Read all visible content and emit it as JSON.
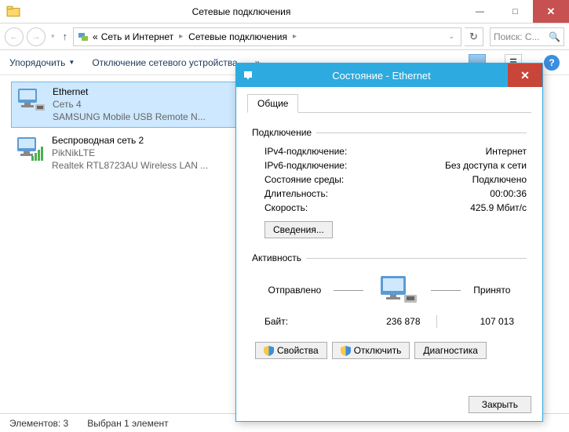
{
  "window": {
    "title": "Сетевые подключения",
    "minimize": "—",
    "maximize": "□",
    "close": "✕"
  },
  "nav": {
    "breadcrumb_prefix": "«",
    "crumb1": "Сеть и Интернет",
    "crumb2": "Сетевые подключения",
    "search_placeholder": "Поиск: С..."
  },
  "toolbar": {
    "organize": "Упорядочить",
    "disable": "Отключение сетевого устройства",
    "more": "»"
  },
  "connections": [
    {
      "name": "Ethernet",
      "line2": "Сеть  4",
      "line3": "SAMSUNG Mobile USB Remote N..."
    },
    {
      "name": "Беспроводная сеть 2",
      "line2": "PikNikLTE",
      "line3": "Realtek RTL8723AU Wireless LAN ..."
    }
  ],
  "statusbar": {
    "items": "Элементов: 3",
    "selected": "Выбран 1 элемент"
  },
  "dialog": {
    "title": "Состояние - Ethernet",
    "close": "✕",
    "tab_general": "Общие",
    "group_connection": "Подключение",
    "ipv4_label": "IPv4-подключение:",
    "ipv4_value": "Интернет",
    "ipv6_label": "IPv6-подключение:",
    "ipv6_value": "Без доступа к сети",
    "media_label": "Состояние среды:",
    "media_value": "Подключено",
    "duration_label": "Длительность:",
    "duration_value": "00:00:36",
    "speed_label": "Скорость:",
    "speed_value": "425.9 Мбит/с",
    "details_btn": "Сведения...",
    "group_activity": "Активность",
    "sent_label": "Отправлено",
    "recv_label": "Принято",
    "bytes_label": "Байт:",
    "bytes_sent": "236 878",
    "bytes_recv": "107 013",
    "properties_btn": "Свойства",
    "disable_btn": "Отключить",
    "diagnose_btn": "Диагностика",
    "close_btn": "Закрыть"
  }
}
